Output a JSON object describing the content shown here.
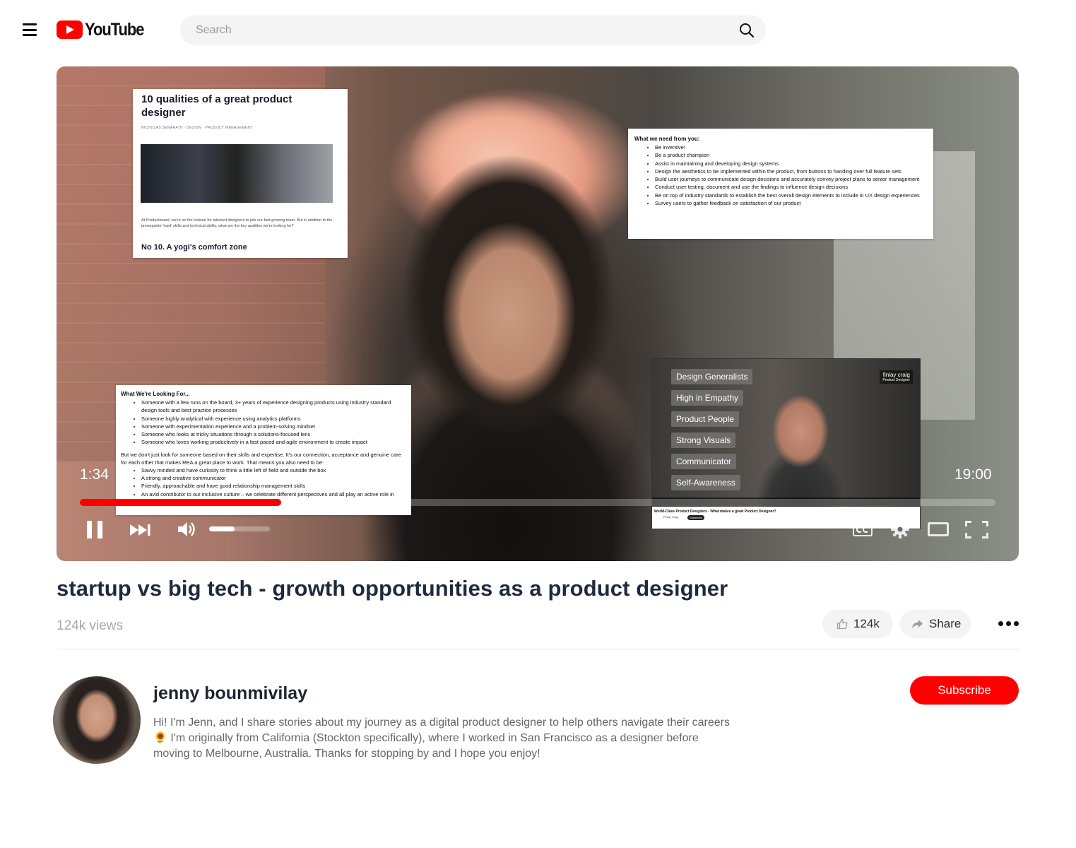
{
  "header": {
    "logo_text": "YouTube",
    "search_placeholder": "Search"
  },
  "player": {
    "current_time": "1:34",
    "duration": "19:00",
    "progress": 0.22,
    "volume": 0.42,
    "overlay_article": {
      "title": "10 qualities of a great product designer",
      "meta": "NICHOLAS SENARATH  ·  DESIGN  ·  PRODUCT MANAGEMENT",
      "body": "At Productboard, we're on the lookout for talented designers to join our fast-growing team. But in addition to the prerequisite 'hard' skills and technical ability, what are the key qualities we're looking for?",
      "subheading": "No 10. A yogi's comfort zone"
    },
    "overlay_needs": {
      "heading": "What we need from you:",
      "items": [
        "Be inventive!",
        "Be a product champion",
        "Assist in maintaining and developing design systems",
        "Design the aesthetics to be implemented within the product, from buttons to handing over full feature sets",
        "Build user journeys to communicate design decisions and accurately convey project plans to senior management",
        "Conduct user testing, document and use the findings to influence design decisions",
        "Be on top of industry standards to establish the best overall design elements to include in UX design experiences",
        "Survey users to gather feedback on satisfaction of our product"
      ]
    },
    "overlay_looking": {
      "heading": "What We're Looking For...",
      "items": [
        "Someone with a few runs on the board, 3+ years of experience designing products using industry standard design tools and best practice processes",
        "Someone highly analytical with experience using analytics platforms",
        "Someone with experimentation experience and a problem-solving mindset",
        "Someone who looks at tricky situations through a solutions-focused lens",
        "Someone who loves working productively in a fast paced and agile environment to create impact"
      ],
      "paragraph": "But we don't just look for someone based on their skills and expertise. It's our connection, acceptance and genuine care for each other that makes REA a great place to work. That means you also need to be:",
      "items2": [
        "Savvy minded and have curiosity to think a little left of field and outside the box",
        "A strong and creative communicator",
        "Friendly, approachable and have good relationship management skills",
        "An avid contributor to our inclusive culture – we celebrate different perspectives and all play an active role in creating a sense of belonging"
      ]
    },
    "pip": {
      "tags": [
        "Design Generalists",
        "High in Empathy",
        "Product People",
        "Strong Visuals",
        "Communicator",
        "Self-Awareness"
      ],
      "name_tag": "finlay craig",
      "name_role": "Product Designer",
      "bar_title": "World-Class Product Designers - What makes a great Product Designer?",
      "bar_channel": "Finlay Craig",
      "bar_subscribe": "Subscribe"
    }
  },
  "video": {
    "title": "startup vs big tech - growth opportunities as a product designer",
    "views": "124k views",
    "likes": "124k",
    "share_label": "Share"
  },
  "channel": {
    "name": "jenny bounmivilay",
    "description": "Hi! I'm Jenn, and I share stories about my journey as a digital product designer to help others navigate their careers 🌻 I'm originally from California (Stockton specifically), where I worked in San Francisco as a designer before moving to Melbourne, Australia. Thanks for stopping by and I hope you enjoy!",
    "subscribe_label": "Subscribe"
  },
  "colors": {
    "accent": "#ff0000",
    "title": "#1f2a3c",
    "muted": "#a9a9a9"
  }
}
